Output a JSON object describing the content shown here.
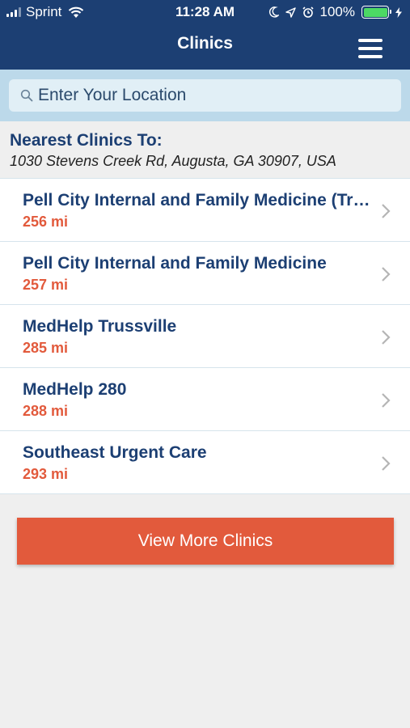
{
  "status_bar": {
    "carrier": "Sprint",
    "time": "11:28 AM",
    "battery": "100%"
  },
  "nav": {
    "title": "Clinics",
    "menu_icon": "hamburger-menu-icon"
  },
  "search": {
    "placeholder": "Enter Your Location",
    "icon": "search-icon"
  },
  "nearest": {
    "label": "Nearest Clinics To:",
    "address": "1030 Stevens Creek Rd, Augusta, GA 30907, USA"
  },
  "clinics": [
    {
      "name": "Pell City Internal and Family Medicine (Trussville)",
      "distance": "256 mi"
    },
    {
      "name": "Pell City Internal and Family Medicine",
      "distance": "257 mi"
    },
    {
      "name": "MedHelp Trussville",
      "distance": "285 mi"
    },
    {
      "name": "MedHelp 280",
      "distance": "288 mi"
    },
    {
      "name": "Southeast Urgent Care",
      "distance": "293 mi"
    }
  ],
  "view_more_label": "View More Clinics",
  "colors": {
    "header": "#1c3f73",
    "accent": "#e25a3c",
    "search_band": "#bcd9ea",
    "battery": "#4cd964"
  }
}
